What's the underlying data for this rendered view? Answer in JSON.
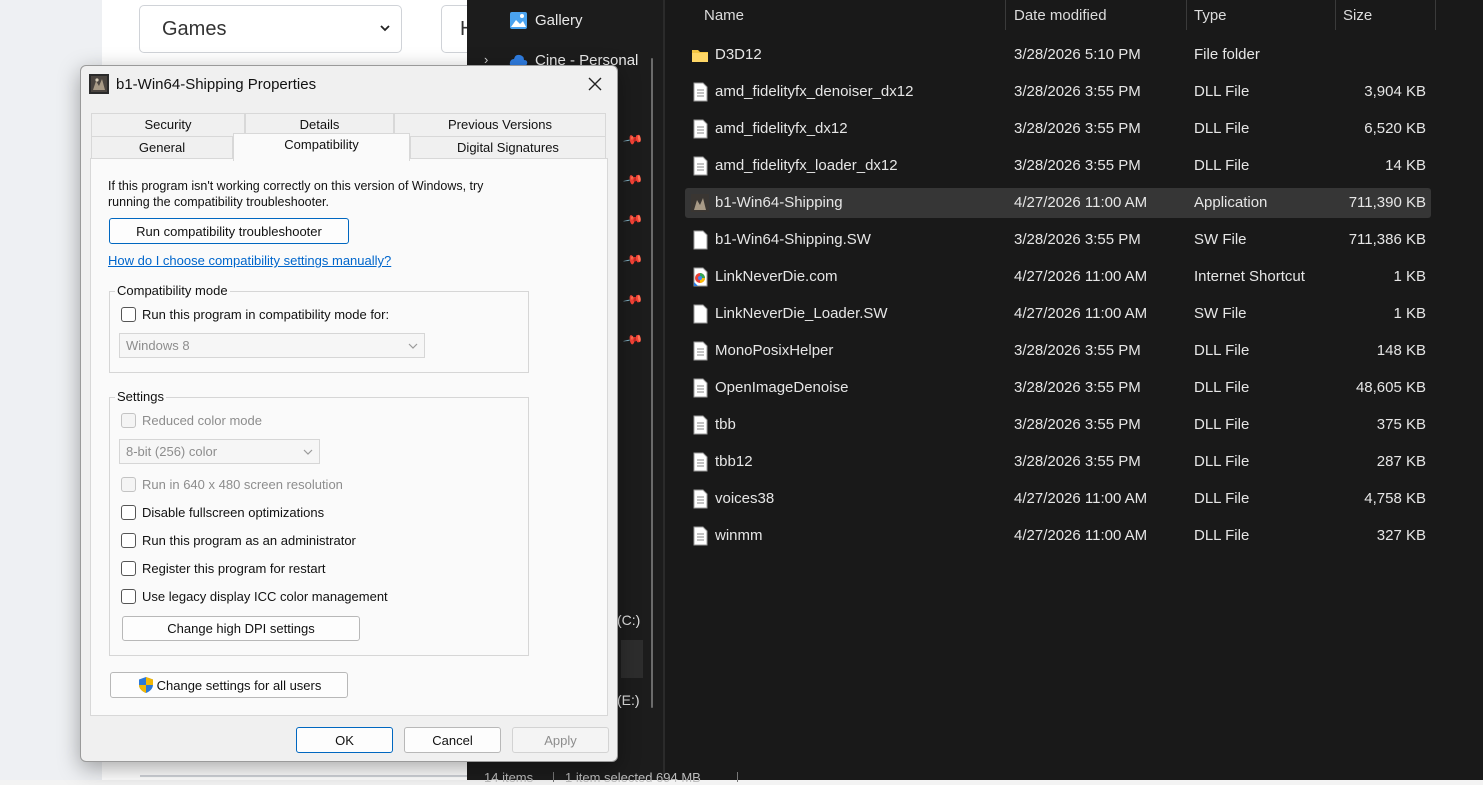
{
  "background_page": {
    "select_value": "Games",
    "second_select_value": "H"
  },
  "explorer": {
    "nav_items": [
      {
        "label": "Gallery",
        "icon": "gallery-icon"
      },
      {
        "label": "Cine - Personal",
        "icon": "cloud-icon"
      }
    ],
    "drive_c": "(C:)",
    "drive_e": "(E:)",
    "columns": {
      "name": "Name",
      "date": "Date modified",
      "type": "Type",
      "size": "Size"
    },
    "files": [
      {
        "name": "D3D12",
        "date": "3/28/2026 5:10 PM",
        "type": "File folder",
        "size": "",
        "icon": "folder-icon"
      },
      {
        "name": "amd_fidelityfx_denoiser_dx12",
        "date": "3/28/2026 3:55 PM",
        "type": "DLL File",
        "size": "3,904 KB",
        "icon": "dll-file-icon"
      },
      {
        "name": "amd_fidelityfx_dx12",
        "date": "3/28/2026 3:55 PM",
        "type": "DLL File",
        "size": "6,520 KB",
        "icon": "dll-file-icon"
      },
      {
        "name": "amd_fidelityfx_loader_dx12",
        "date": "3/28/2026 3:55 PM",
        "type": "DLL File",
        "size": "14 KB",
        "icon": "dll-file-icon"
      },
      {
        "name": "b1-Win64-Shipping",
        "date": "4/27/2026 11:00 AM",
        "type": "Application",
        "size": "711,390 KB",
        "icon": "app-icon",
        "selected": true
      },
      {
        "name": "b1-Win64-Shipping.SW",
        "date": "3/28/2026 3:55 PM",
        "type": "SW File",
        "size": "711,386 KB",
        "icon": "file-icon"
      },
      {
        "name": "LinkNeverDie.com",
        "date": "4/27/2026 11:00 AM",
        "type": "Internet Shortcut",
        "size": "1 KB",
        "icon": "internet-shortcut-icon"
      },
      {
        "name": "LinkNeverDie_Loader.SW",
        "date": "4/27/2026 11:00 AM",
        "type": "SW File",
        "size": "1 KB",
        "icon": "file-icon"
      },
      {
        "name": "MonoPosixHelper",
        "date": "3/28/2026 3:55 PM",
        "type": "DLL File",
        "size": "148 KB",
        "icon": "dll-file-icon"
      },
      {
        "name": "OpenImageDenoise",
        "date": "3/28/2026 3:55 PM",
        "type": "DLL File",
        "size": "48,605 KB",
        "icon": "dll-file-icon"
      },
      {
        "name": "tbb",
        "date": "3/28/2026 3:55 PM",
        "type": "DLL File",
        "size": "375 KB",
        "icon": "dll-file-icon"
      },
      {
        "name": "tbb12",
        "date": "3/28/2026 3:55 PM",
        "type": "DLL File",
        "size": "287 KB",
        "icon": "dll-file-icon"
      },
      {
        "name": "voices38",
        "date": "4/27/2026 11:00 AM",
        "type": "DLL File",
        "size": "4,758 KB",
        "icon": "dll-file-icon"
      },
      {
        "name": "winmm",
        "date": "4/27/2026 11:00 AM",
        "type": "DLL File",
        "size": "327 KB",
        "icon": "dll-file-icon"
      }
    ],
    "status": {
      "item_count": "14 items",
      "selection": "1 item selected  694 MB"
    }
  },
  "dialog": {
    "title": "b1-Win64-Shipping Properties",
    "tabs_row1": [
      "Security",
      "Details",
      "Previous Versions"
    ],
    "tabs_row2": [
      "General",
      "Compatibility",
      "Digital Signatures"
    ],
    "active_tab": "Compatibility",
    "intro_text": "If this program isn't working correctly on this version of Windows, try running the compatibility troubleshooter.",
    "troubleshooter_button": "Run compatibility troubleshooter",
    "manual_link": "How do I choose compatibility settings manually?",
    "compat_mode": {
      "group_label": "Compatibility mode",
      "checkbox_label": "Run this program in compatibility mode for:",
      "os_value": "Windows 8"
    },
    "settings": {
      "group_label": "Settings",
      "reduced_color": "Reduced color mode",
      "color_value": "8-bit (256) color",
      "run_640": "Run in 640 x 480 screen resolution",
      "disable_fullscreen": "Disable fullscreen optimizations",
      "run_as_admin": "Run this program as an administrator",
      "register_restart": "Register this program for restart",
      "legacy_icc": "Use legacy display ICC color management",
      "dpi_button": "Change high DPI settings"
    },
    "all_users_button": "Change settings for all users",
    "ok": "OK",
    "cancel": "Cancel",
    "apply": "Apply"
  }
}
